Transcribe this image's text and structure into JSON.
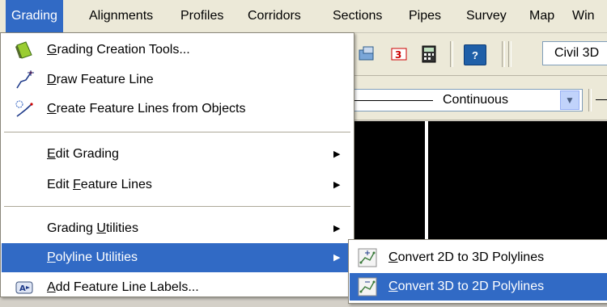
{
  "menubar": {
    "items": [
      "Grading",
      "Alignments",
      "Profiles",
      "Corridors",
      "Sections",
      "Pipes",
      "Survey",
      "Map",
      "Win"
    ],
    "active": "Grading"
  },
  "toolbar": {
    "style_combo_value": "Civil 3D",
    "linetype_value": "Continuous"
  },
  "grading_menu": {
    "items": [
      {
        "pre": "",
        "key": "G",
        "post": "rading Creation Tools...",
        "icon": "grading-tools-icon"
      },
      {
        "pre": "",
        "key": "D",
        "post": "raw Feature Line",
        "icon": "draw-feature-line-icon"
      },
      {
        "pre": "",
        "key": "C",
        "post": "reate Feature Lines from Objects",
        "icon": "create-feature-lines-icon"
      },
      {
        "pre": "",
        "key": "E",
        "post": "dit Grading",
        "submenu": true
      },
      {
        "pre": "Edit ",
        "key": "F",
        "post": "eature Lines",
        "submenu": true
      },
      {
        "pre": "Grading ",
        "key": "U",
        "post": "tilities",
        "submenu": true
      },
      {
        "pre": "",
        "key": "P",
        "post": "olyline Utilities",
        "submenu": true,
        "highlighted": true
      },
      {
        "pre": "",
        "key": "A",
        "post": "dd Feature Line Labels...",
        "icon": "feature-line-labels-icon"
      }
    ]
  },
  "polyline_submenu": {
    "items": [
      {
        "pre": "",
        "key": "C",
        "post": "onvert 2D to 3D Polylines",
        "icon": "convert-2d-to-3d-icon"
      },
      {
        "pre": "",
        "key": "C",
        "post": "onvert 3D to 2D Polylines",
        "icon": "convert-3d-to-2d-icon",
        "highlighted": true
      }
    ]
  },
  "colors": {
    "highlight": "#316ac5",
    "menu_bg": "#ffffff",
    "drawing_bg": "#000000"
  }
}
